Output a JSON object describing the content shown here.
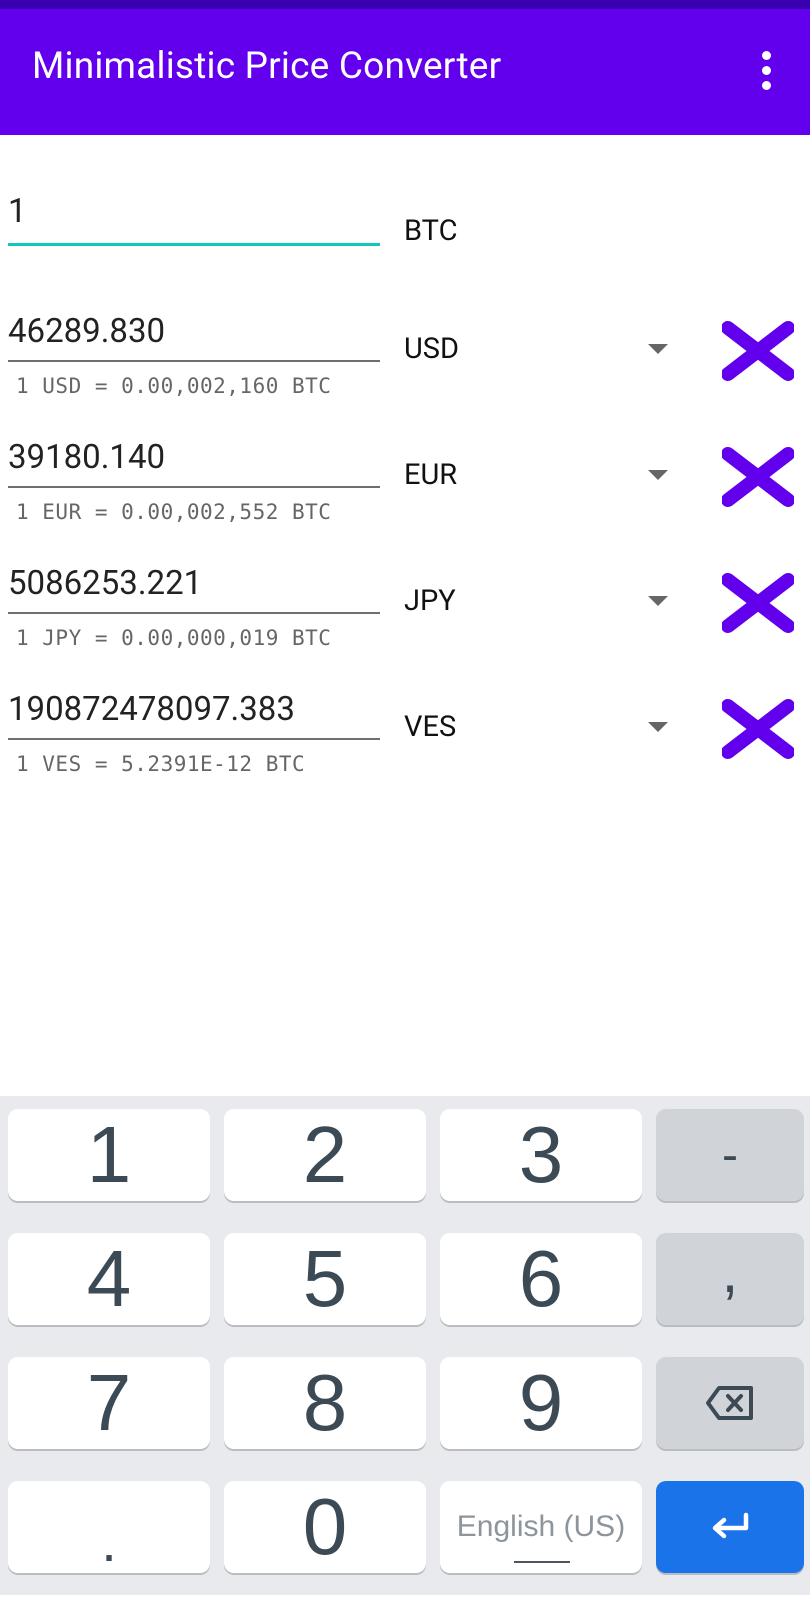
{
  "app": {
    "title": "Minimalistic Price Converter"
  },
  "base": {
    "value": "1",
    "code": "BTC"
  },
  "rows": [
    {
      "amount": "46289.830",
      "code": "USD",
      "rate": "1 USD = 0.00,002,160 BTC"
    },
    {
      "amount": "39180.140",
      "code": "EUR",
      "rate": "1 EUR = 0.00,002,552 BTC"
    },
    {
      "amount": "5086253.221",
      "code": "JPY",
      "rate": "1 JPY = 0.00,000,019 BTC"
    },
    {
      "amount": "190872478097.383",
      "code": "VES",
      "rate": "1 VES = 5.2391E-12 BTC"
    }
  ],
  "keyboard": {
    "keys": [
      "1",
      "2",
      "3",
      "-",
      "4",
      "5",
      "6",
      ",",
      "7",
      "8",
      "9",
      ".",
      "0"
    ],
    "language": "English (US)"
  },
  "colors": {
    "app_bar": "#6200ee",
    "accent": "#13c6bb",
    "remove_icon": "#6200ee",
    "enter_key": "#1a73e8"
  },
  "icons": {
    "overflow": "more-vert-icon",
    "remove": "close-icon",
    "dropdown": "arrow-drop-down-icon",
    "backspace": "backspace-icon",
    "enter": "keyboard-return-icon"
  }
}
